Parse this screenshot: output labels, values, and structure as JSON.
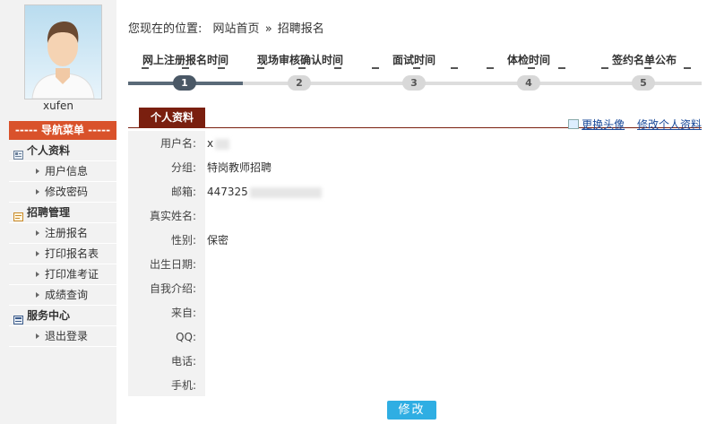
{
  "user": {
    "name": "xufen"
  },
  "nav": {
    "header": "----- 导航菜单 -----",
    "groups": [
      {
        "label": "个人资料",
        "icon": "profile-icon",
        "items": [
          "用户信息",
          "修改密码"
        ]
      },
      {
        "label": "招聘管理",
        "icon": "recruit-icon",
        "items": [
          "注册报名",
          "打印报名表",
          "打印准考证",
          "成绩查询"
        ]
      },
      {
        "label": "服务中心",
        "icon": "service-icon",
        "items": [
          "退出登录"
        ]
      }
    ]
  },
  "breadcrumb": {
    "prefix": "您现在的位置:",
    "home": "网站首页",
    "sep": "»",
    "current": "招聘报名"
  },
  "steps": [
    {
      "label": "网上注册报名时间",
      "num": "1",
      "active": true
    },
    {
      "label": "现场审核确认时间",
      "num": "2",
      "active": false
    },
    {
      "label": "面试时间",
      "num": "3",
      "active": false
    },
    {
      "label": "体检时间",
      "num": "4",
      "active": false
    },
    {
      "label": "签约名单公布",
      "num": "5",
      "active": false
    }
  ],
  "tab": {
    "label": "个人资料"
  },
  "links": {
    "change_avatar": "更换头像",
    "edit_profile": "修改个人资料"
  },
  "fields": [
    {
      "label": "用户名:",
      "value": "x"
    },
    {
      "label": "分组:",
      "value": "特岗教师招聘"
    },
    {
      "label": "邮箱:",
      "value": "447325"
    },
    {
      "label": "真实姓名:",
      "value": ""
    },
    {
      "label": "性别:",
      "value": "保密"
    },
    {
      "label": "出生日期:",
      "value": ""
    },
    {
      "label": "自我介绍:",
      "value": ""
    },
    {
      "label": "来自:",
      "value": ""
    },
    {
      "label": "QQ:",
      "value": ""
    },
    {
      "label": "电话:",
      "value": ""
    },
    {
      "label": "手机:",
      "value": ""
    }
  ],
  "button": {
    "label": "修改"
  },
  "colors": {
    "nav_head": "#d9522b",
    "tab": "#7a1f0f",
    "button": "#2faee3",
    "link": "#1a4a9a"
  }
}
